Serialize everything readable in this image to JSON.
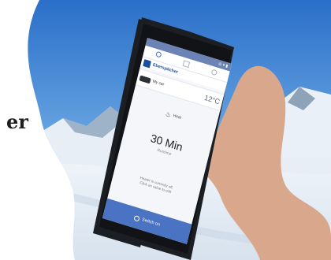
{
  "page_fragment": "er",
  "app": {
    "status_bar": "◎ ▾ ▮",
    "brand": "Eberspächer",
    "car_name": "My car",
    "temperature": "12°C",
    "mode": "Heat",
    "duration": "30 Min",
    "duration_caption": "Runtime",
    "status_line_1": "Heater is currently off.",
    "status_line_2": "Click on value to edit",
    "switch_button": "Switch on"
  },
  "colors": {
    "sky": "#3f86d6",
    "snow": "#eef3f8",
    "phone_body": "#1b1e23",
    "app_accent": "#4a73c4",
    "brand_blue": "#1b4f9b"
  }
}
